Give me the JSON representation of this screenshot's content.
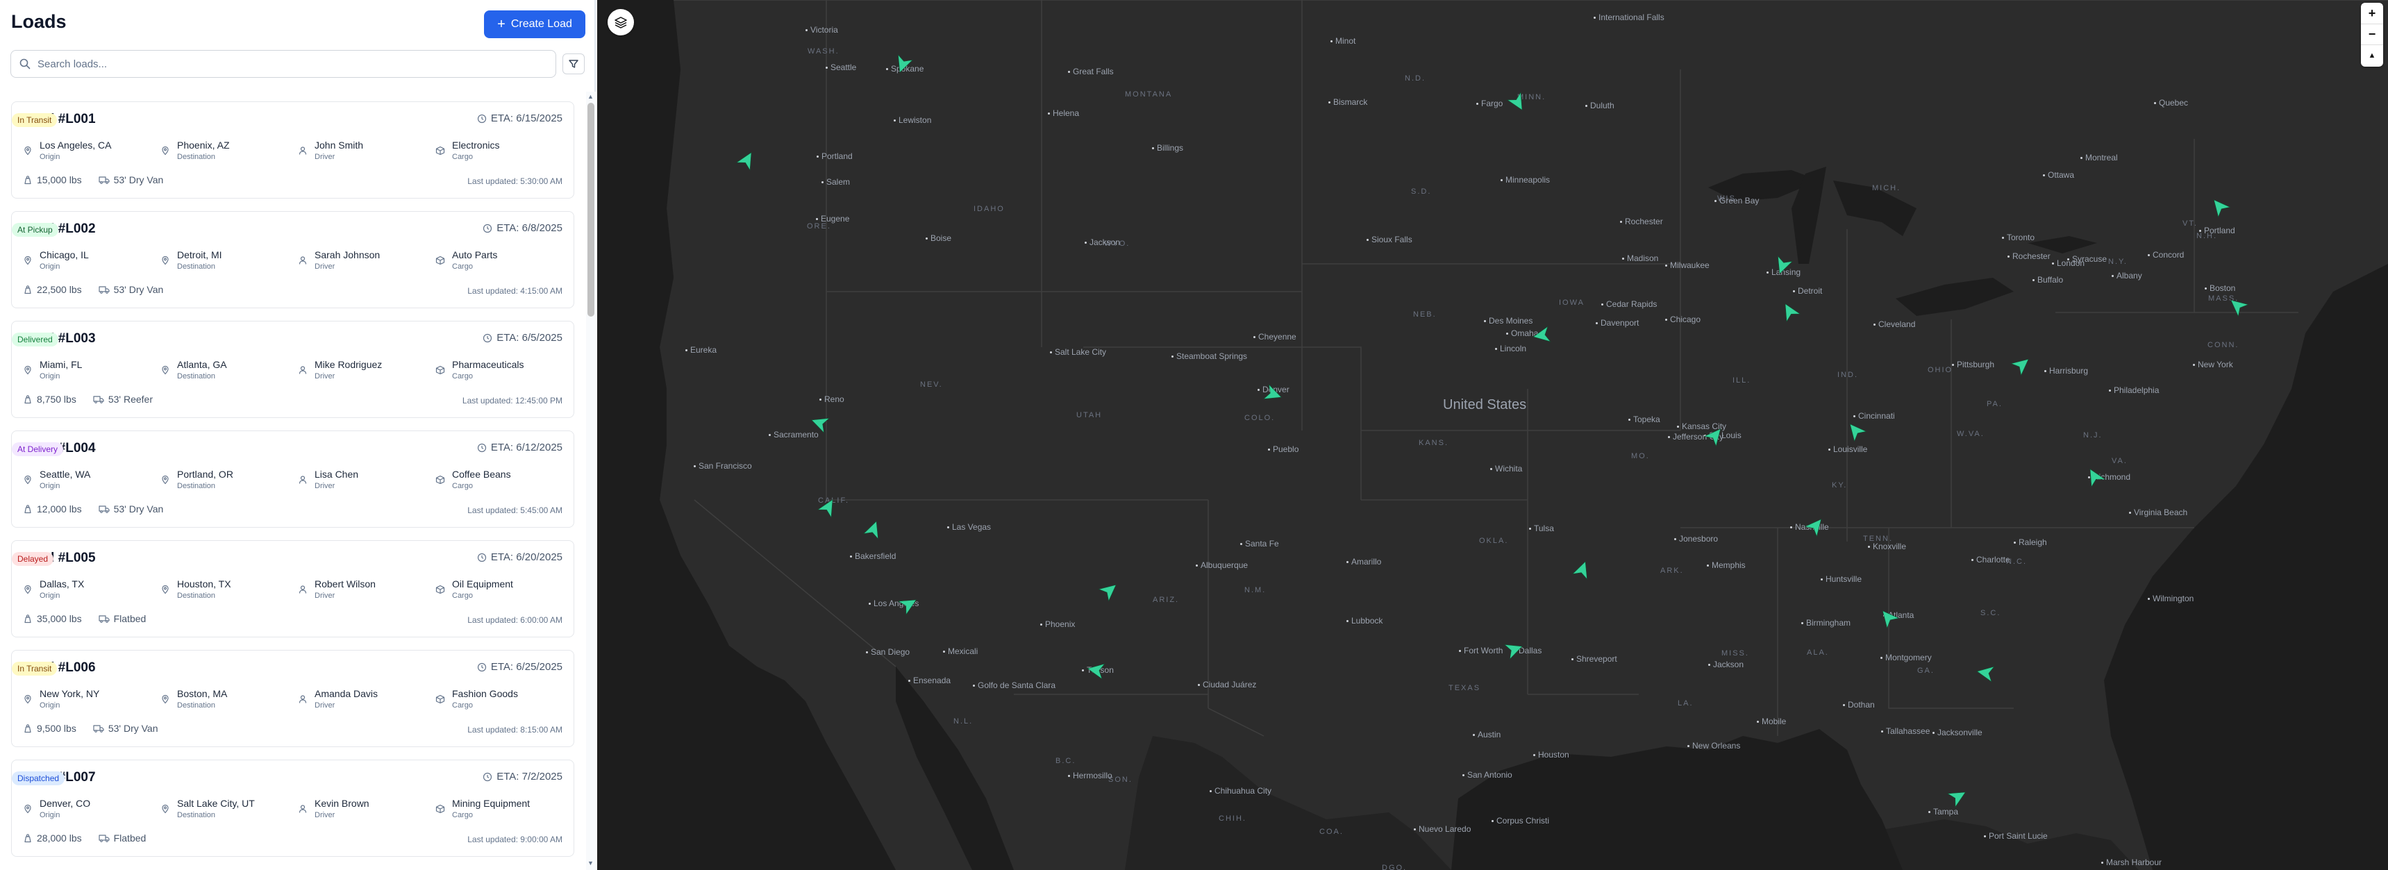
{
  "panel": {
    "title": "Loads",
    "create_label": "Create Load",
    "search_placeholder": "Search loads...",
    "labels": {
      "origin": "Origin",
      "destination": "Destination",
      "driver": "Driver",
      "cargo": "Cargo"
    }
  },
  "loads": [
    {
      "id": "Load #L001",
      "status": "In Transit",
      "eta": "ETA: 6/15/2025",
      "origin": "Los Angeles, CA",
      "destination": "Phoenix, AZ",
      "driver": "John Smith",
      "cargo": "Electronics",
      "weight": "15,000 lbs",
      "equipment": "53' Dry Van",
      "updated": "Last updated: 5:30:00 AM"
    },
    {
      "id": "Load #L002",
      "status": "At Pickup",
      "eta": "ETA: 6/8/2025",
      "origin": "Chicago, IL",
      "destination": "Detroit, MI",
      "driver": "Sarah Johnson",
      "cargo": "Auto Parts",
      "weight": "22,500 lbs",
      "equipment": "53' Dry Van",
      "updated": "Last updated: 4:15:00 AM"
    },
    {
      "id": "Load #L003",
      "status": "Delivered",
      "eta": "ETA: 6/5/2025",
      "origin": "Miami, FL",
      "destination": "Atlanta, GA",
      "driver": "Mike Rodriguez",
      "cargo": "Pharmaceuticals",
      "weight": "8,750 lbs",
      "equipment": "53' Reefer",
      "updated": "Last updated: 12:45:00 PM"
    },
    {
      "id": "Load #L004",
      "status": "At Delivery",
      "eta": "ETA: 6/12/2025",
      "origin": "Seattle, WA",
      "destination": "Portland, OR",
      "driver": "Lisa Chen",
      "cargo": "Coffee Beans",
      "weight": "12,000 lbs",
      "equipment": "53' Dry Van",
      "updated": "Last updated: 5:45:00 AM"
    },
    {
      "id": "Load #L005",
      "status": "Delayed",
      "eta": "ETA: 6/20/2025",
      "origin": "Dallas, TX",
      "destination": "Houston, TX",
      "driver": "Robert Wilson",
      "cargo": "Oil Equipment",
      "weight": "35,000 lbs",
      "equipment": "Flatbed",
      "updated": "Last updated: 6:00:00 AM"
    },
    {
      "id": "Load #L006",
      "status": "In Transit",
      "eta": "ETA: 6/25/2025",
      "origin": "New York, NY",
      "destination": "Boston, MA",
      "driver": "Amanda Davis",
      "cargo": "Fashion Goods",
      "weight": "9,500 lbs",
      "equipment": "53' Dry Van",
      "updated": "Last updated: 8:15:00 AM"
    },
    {
      "id": "Load #L007",
      "status": "Dispatched",
      "eta": "ETA: 7/2/2025",
      "origin": "Denver, CO",
      "destination": "Salt Lake City, UT",
      "driver": "Kevin Brown",
      "cargo": "Mining Equipment",
      "weight": "28,000 lbs",
      "equipment": "Flatbed",
      "updated": "Last updated: 9:00:00 AM"
    }
  ],
  "status_colors": {
    "In Transit": {
      "bg": "#fef9c3",
      "fg": "#854d0e"
    },
    "At Pickup": {
      "bg": "#dcfce7",
      "fg": "#166534"
    },
    "Delivered": {
      "bg": "#dcfce7",
      "fg": "#15803d"
    },
    "At Delivery": {
      "bg": "#f3e8ff",
      "fg": "#7e22ce"
    },
    "Delayed": {
      "bg": "#fee2e2",
      "fg": "#b91c1c"
    },
    "Dispatched": {
      "bg": "#dbeafe",
      "fg": "#1d4ed8"
    }
  },
  "colors": {
    "accent": "#2563eb",
    "map_bg": "#232323",
    "truck": "#34d399"
  },
  "map": {
    "country_label": "United States",
    "controls": {
      "zoom_in": "+",
      "zoom_out": "−",
      "compass": "▲"
    },
    "cities": [
      "Victoria",
      "Seattle",
      "Spokane",
      "Great Falls",
      "Minot",
      "Bismarck",
      "Fargo",
      "Duluth",
      "Portland",
      "Salem",
      "Eugene",
      "Helena",
      "Billings",
      "Lewiston",
      "Boise",
      "Jackson",
      "Sioux Falls",
      "Minneapolis",
      "Rochester",
      "Green Bay",
      "Ottawa",
      "Montreal",
      "Quebec",
      "Madison",
      "Milwaukee",
      "Lansing",
      "Detroit",
      "Toronto",
      "London",
      "Rochester",
      "Syracuse",
      "Albany",
      "Concord",
      "Portland",
      "Boston",
      "Buffalo",
      "Cleveland",
      "Chicago",
      "Des Moines",
      "Cedar Rapids",
      "Davenport",
      "Omaha",
      "Lincoln",
      "Cheyenne",
      "Salt Lake City",
      "Steamboat Springs",
      "Denver",
      "Pueblo",
      "Reno",
      "Sacramento",
      "San Francisco",
      "Eureka",
      "Pittsburgh",
      "Harrisburg",
      "Philadelphia",
      "New York",
      "Cincinnati",
      "Louisville",
      "Kansas City",
      "Topeka",
      "Jefferson City",
      "St. Louis",
      "Wichita",
      "Tulsa",
      "Jonesboro",
      "Memphis",
      "Nashville",
      "Huntsville",
      "Knoxville",
      "Charlotte",
      "Raleigh",
      "Richmond",
      "Virginia Beach",
      "Wilmington",
      "Birmingham",
      "Atlanta",
      "Montgomery",
      "Jackson",
      "Shreveport",
      "Dallas",
      "Fort Worth",
      "Amarillo",
      "Lubbock",
      "Albuquerque",
      "Santa Fe",
      "Las Vegas",
      "Bakersfield",
      "Los Angeles",
      "San Diego",
      "Mexicali",
      "Ensenada",
      "Golfo de Santa Clara",
      "Tucson",
      "Phoenix",
      "Ciudad Juárez",
      "Hermosillo",
      "Chihuahua City",
      "Austin",
      "San Antonio",
      "Houston",
      "New Orleans",
      "Tallahassee",
      "Jacksonville",
      "Mobile",
      "Dothan",
      "Tampa",
      "Port Saint Lucie",
      "Nuevo Laredo",
      "Corpus Christi",
      "Marsh Harbour",
      "International Falls"
    ],
    "regions": [
      "WASH.",
      "MONTANA",
      "N.D.",
      "MINN.",
      "ORE.",
      "IDAHO",
      "WYO.",
      "S.D.",
      "NEB.",
      "IOWA",
      "WIS.",
      "MICH.",
      "NEV.",
      "UTAH",
      "COLO.",
      "KANS.",
      "MO.",
      "ILL.",
      "IND.",
      "OHIO",
      "PA.",
      "N.Y.",
      "VT.",
      "N.H.",
      "MASS.",
      "CONN.",
      "N.J.",
      "W.VA.",
      "VA.",
      "KY.",
      "TENN.",
      "N.C.",
      "S.C.",
      "GA.",
      "ALA.",
      "MISS.",
      "ARK.",
      "LA.",
      "OKLA.",
      "TEXAS",
      "N.M.",
      "ARIZ.",
      "CALIF.",
      "B.C.",
      "SON.",
      "CHIH.",
      "COA.",
      "DGO.",
      "N.L."
    ],
    "trucks": 32
  }
}
